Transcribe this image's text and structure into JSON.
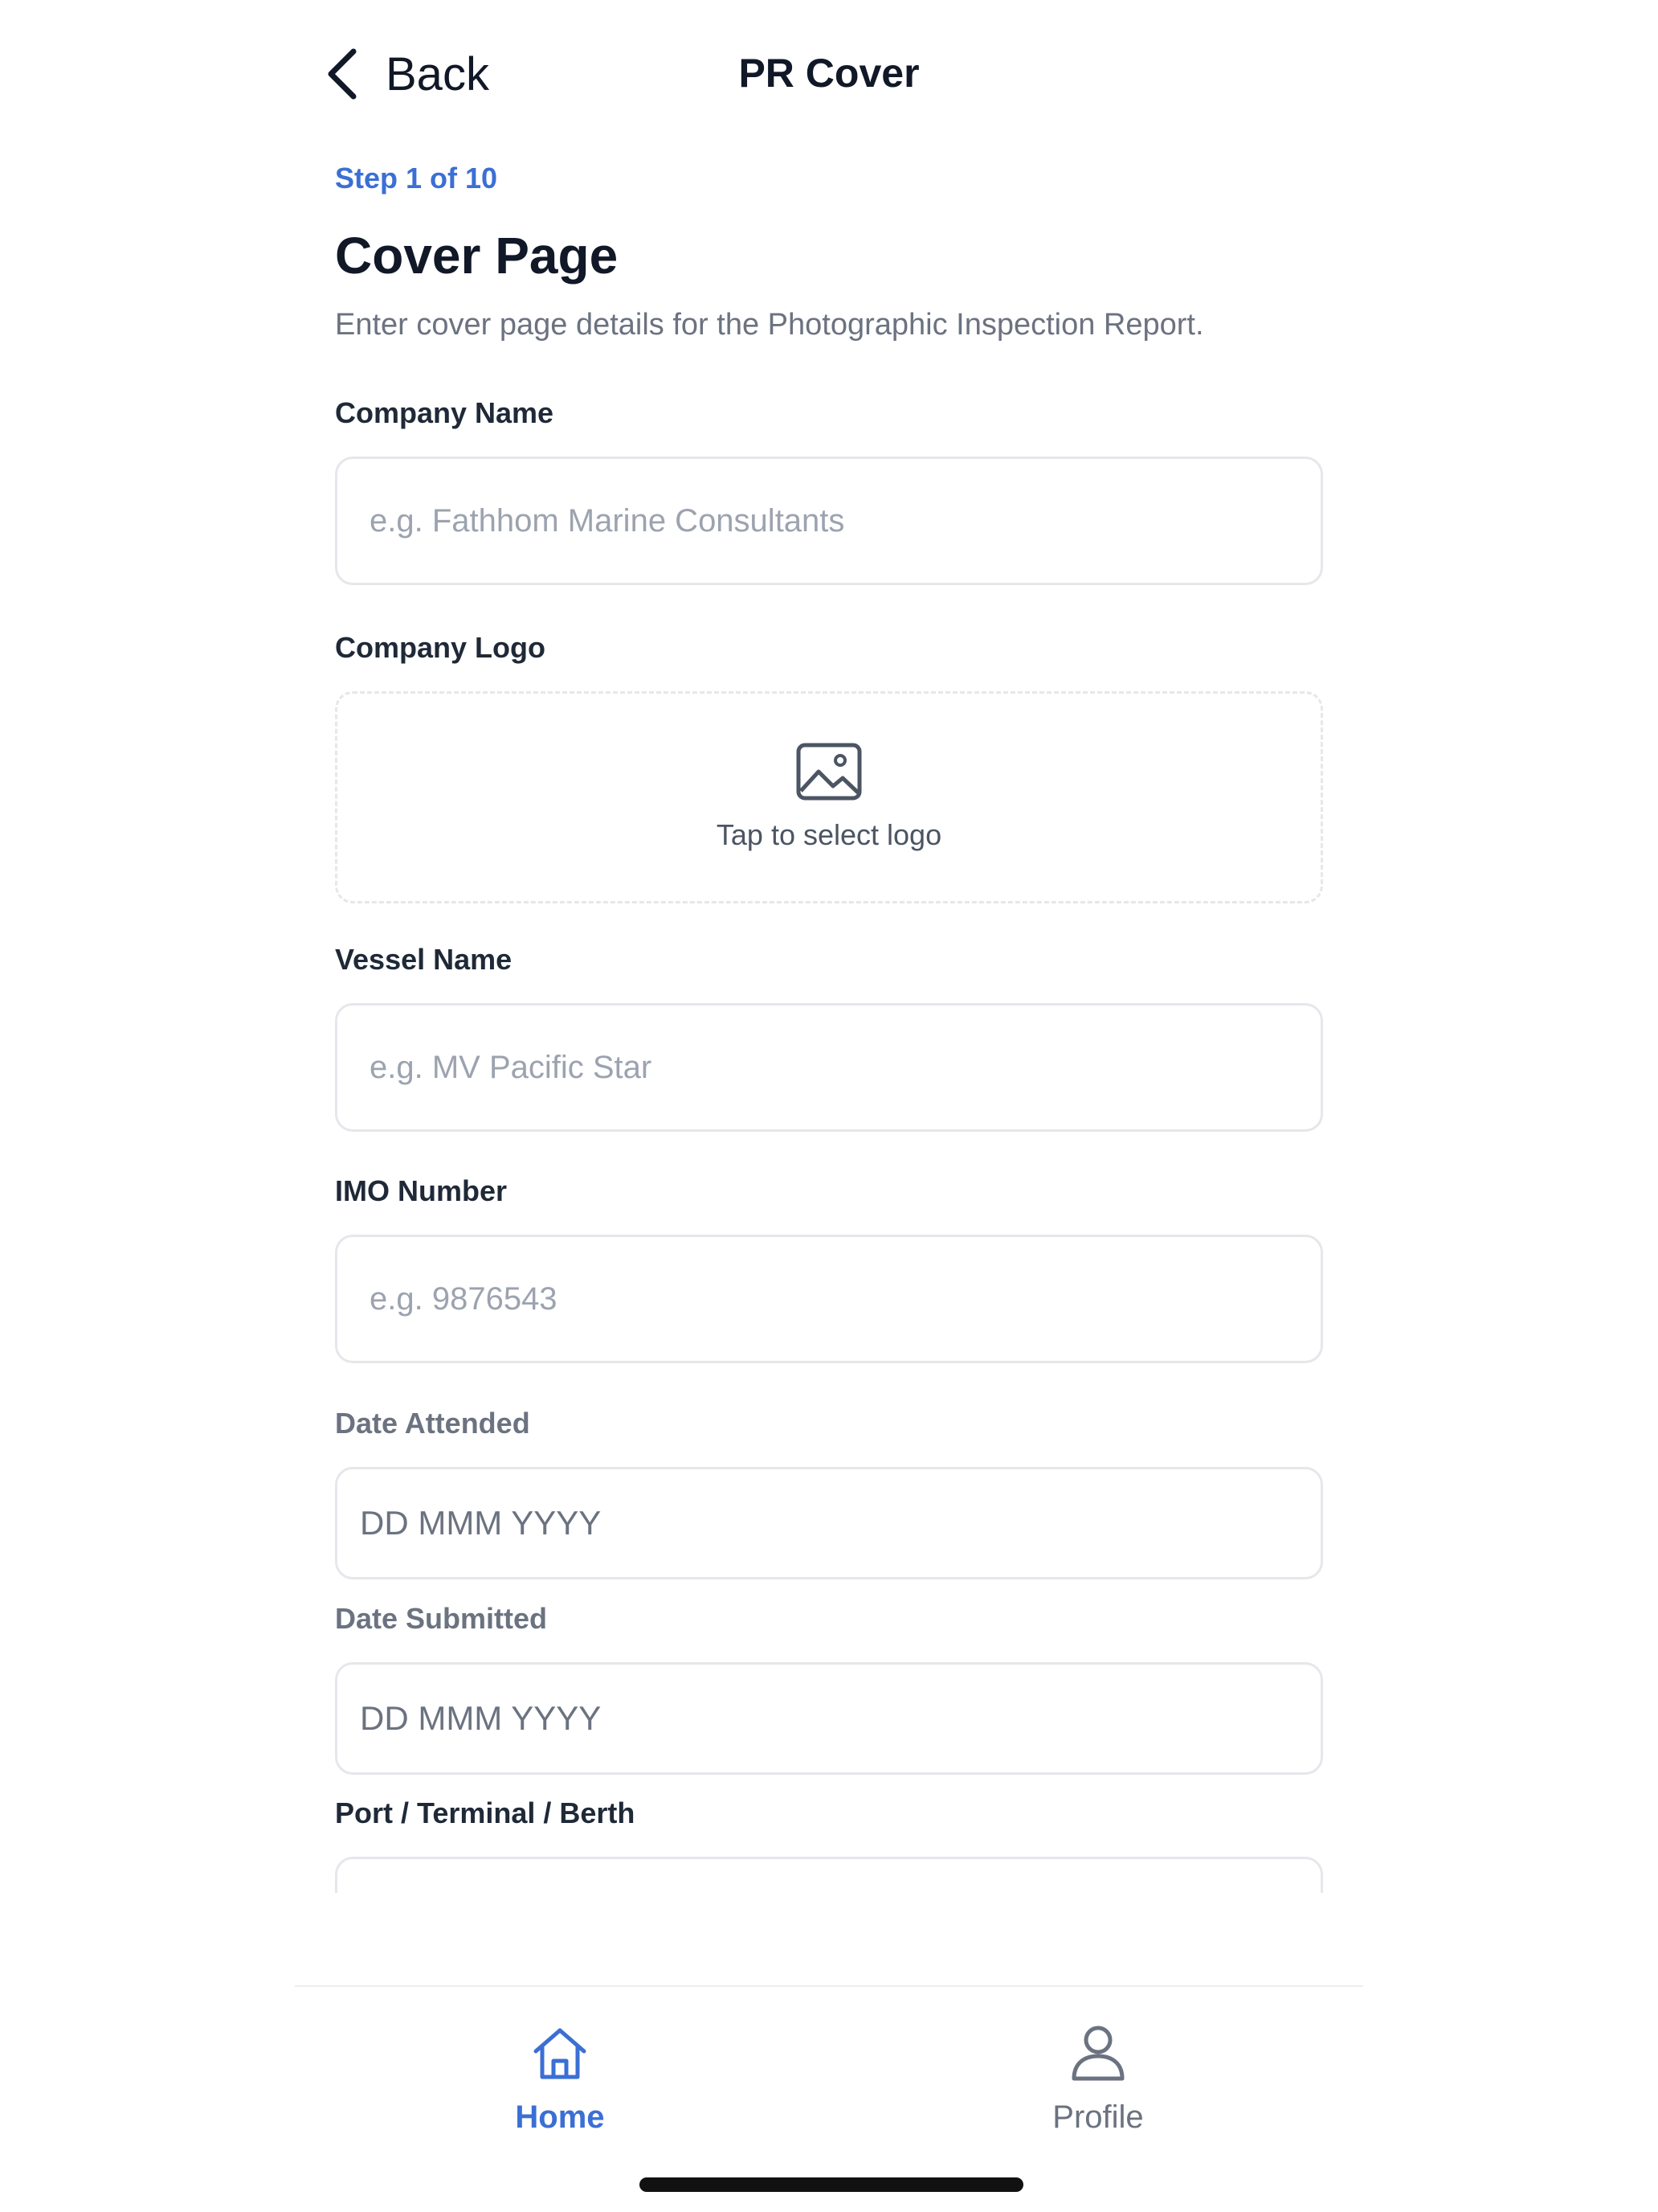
{
  "nav": {
    "back_label": "Back",
    "title": "PR Cover"
  },
  "header": {
    "step": "Step 1 of 10",
    "title": "Cover Page",
    "subtitle": "Enter cover page details for the Photographic Inspection Report."
  },
  "form": {
    "company_name": {
      "label": "Company Name",
      "placeholder": "e.g. Fathhom Marine Consultants"
    },
    "company_logo": {
      "label": "Company Logo",
      "prompt": "Tap to select logo",
      "icon": "image-icon"
    },
    "vessel_name": {
      "label": "Vessel Name",
      "placeholder": "e.g. MV Pacific Star"
    },
    "imo_number": {
      "label": "IMO Number",
      "placeholder": "e.g. 9876543"
    },
    "date_attended": {
      "label": "Date Attended",
      "placeholder": "DD MMM YYYY"
    },
    "date_submitted": {
      "label": "Date Submitted",
      "placeholder": "DD MMM YYYY"
    },
    "port": {
      "label": "Port / Terminal / Berth"
    }
  },
  "tabbar": {
    "items": [
      {
        "label": "Home",
        "icon": "home-icon",
        "active": true
      },
      {
        "label": "Profile",
        "icon": "profile-icon",
        "active": false
      }
    ]
  },
  "colors": {
    "accent": "#3b6fd4",
    "text": "#111827",
    "muted": "#6b7280",
    "border": "#e5e7eb"
  }
}
